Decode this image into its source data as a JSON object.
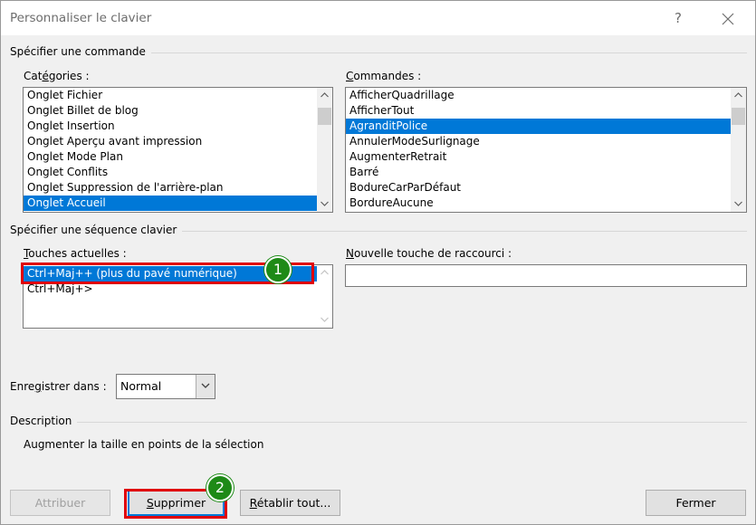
{
  "window": {
    "title": "Personnaliser le clavier",
    "help_glyph": "?",
    "close_glyph": "×"
  },
  "command_group": {
    "title": "Spécifier une commande",
    "categories_label": "Catégories :",
    "categories_label_pre": "Cat",
    "categories_label_key": "é",
    "categories_label_post": "gories :",
    "categories": [
      {
        "label": "Onglet Fichier",
        "selected": false
      },
      {
        "label": "Onglet Billet de blog",
        "selected": false
      },
      {
        "label": "Onglet Insertion",
        "selected": false
      },
      {
        "label": "Onglet Aperçu avant impression",
        "selected": false
      },
      {
        "label": "Onglet Mode Plan",
        "selected": false
      },
      {
        "label": "Onglet Conflits",
        "selected": false
      },
      {
        "label": "Onglet Suppression de l'arrière-plan",
        "selected": false
      },
      {
        "label": "Onglet Accueil",
        "selected": true
      }
    ],
    "commands_label_key": "C",
    "commands_label_post": "ommandes :",
    "commands": [
      {
        "label": "AfficherQuadrillage",
        "selected": false
      },
      {
        "label": "AfficherTout",
        "selected": false
      },
      {
        "label": "AgranditPolice",
        "selected": true
      },
      {
        "label": "AnnulerModeSurlignage",
        "selected": false
      },
      {
        "label": "AugmenterRetrait",
        "selected": false
      },
      {
        "label": "Barré",
        "selected": false
      },
      {
        "label": "BodureCarParDéfaut",
        "selected": false
      },
      {
        "label": "BordureAucune",
        "selected": false
      }
    ]
  },
  "keyboard_group": {
    "title": "Spécifier une séquence clavier",
    "current_keys_label_key": "T",
    "current_keys_label_post": "ouches actuelles :",
    "current_keys": [
      {
        "label": "Ctrl+Maj++ (plus du pavé numérique)",
        "selected": true
      },
      {
        "label": "Ctrl+Maj+>",
        "selected": false
      }
    ],
    "new_key_label_key": "N",
    "new_key_label_post": "ouvelle touche de raccourci :",
    "new_key_value": ""
  },
  "save_in": {
    "label_pre": "Enre",
    "label_key": "g",
    "label_post": "istrer dans :",
    "value": "Normal"
  },
  "description": {
    "title": "Description",
    "text": "Augmenter la taille en points de la sélection"
  },
  "buttons": {
    "assign": "Attribuer",
    "remove_key": "S",
    "remove_post": "upprimer",
    "reset_key": "R",
    "reset_post": "établir tout...",
    "close": "Fermer"
  },
  "annotations": {
    "badge_1": "1",
    "badge_2": "2",
    "highlight_color": "#e0000b",
    "badge_color": "#1e8a17"
  },
  "colors": {
    "selection": "#0078d7",
    "dialog_bg": "#f0f0f0"
  }
}
